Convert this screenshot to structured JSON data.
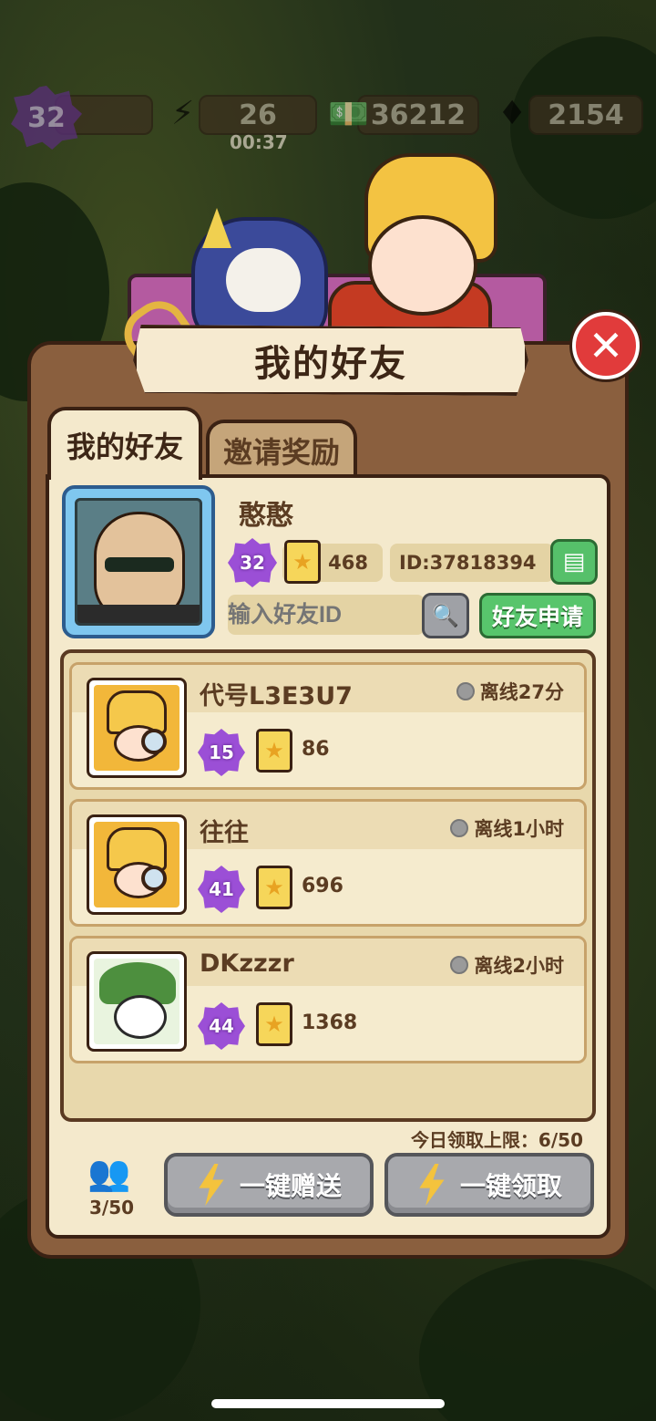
{
  "hud": {
    "level": "32",
    "energy": "26",
    "energy_timer": "00:37",
    "cash": "36212",
    "gems": "2154"
  },
  "dialog": {
    "title": "我的好友",
    "close_icon": "close-icon"
  },
  "tabs": [
    {
      "label": "我的好友",
      "active": true
    },
    {
      "label": "邀请奖励",
      "active": false
    }
  ],
  "me": {
    "name": "憨憨",
    "level": "32",
    "cards": "468",
    "id": "ID:37818394",
    "search_placeholder": "输入好友ID",
    "apply_label": "好友申请"
  },
  "friends": [
    {
      "name": "代号L3E3U7",
      "status": "离线27分",
      "level": "15",
      "cards": "86"
    },
    {
      "name": "往往",
      "status": "离线1小时",
      "level": "41",
      "cards": "696"
    },
    {
      "name": "DKzzzr",
      "status": "离线2小时",
      "level": "44",
      "cards": "1368"
    }
  ],
  "footer": {
    "daily_limit": "今日领取上限：6/50",
    "friend_count": "3/50",
    "send_all_label": "一键赠送",
    "claim_all_label": "一键领取"
  },
  "colors": {
    "panel": "#8a5f3e",
    "content": "#f4e9cc",
    "accent_green": "#58c56c",
    "close_red": "#e13b3b",
    "level_purple": "#9b4fd6"
  }
}
